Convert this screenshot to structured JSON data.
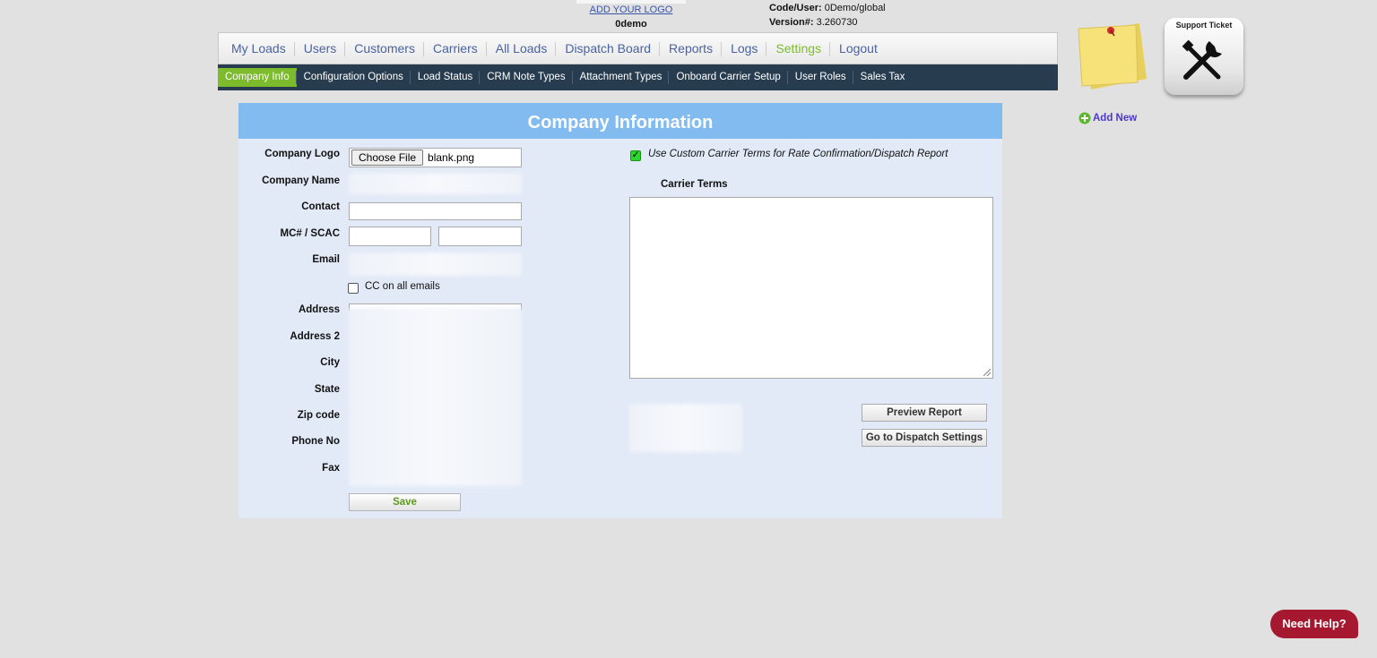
{
  "header": {
    "add_logo_link": "ADD YOUR LOGO",
    "company_code": "0demo",
    "code_user_label": "Code/User:",
    "code_user_value": "0Demo/global",
    "version_label": "Version#:",
    "version_value": "3.260730"
  },
  "main_nav": {
    "items": [
      {
        "label": "My Loads"
      },
      {
        "label": "Users"
      },
      {
        "label": "Customers"
      },
      {
        "label": "Carriers"
      },
      {
        "label": "All Loads"
      },
      {
        "label": "Dispatch Board"
      },
      {
        "label": "Reports"
      },
      {
        "label": "Logs"
      },
      {
        "label": "Settings"
      },
      {
        "label": "Logout"
      }
    ],
    "active": "Settings"
  },
  "sub_nav": {
    "items": [
      {
        "label": "Company Info"
      },
      {
        "label": "Configuration Options"
      },
      {
        "label": "Load Status"
      },
      {
        "label": "CRM Note Types"
      },
      {
        "label": "Attachment Types"
      },
      {
        "label": "Onboard Carrier Setup"
      },
      {
        "label": "User Roles"
      },
      {
        "label": "Sales Tax"
      }
    ],
    "active": "Company Info"
  },
  "panel": {
    "title": "Company Information",
    "labels": {
      "company_logo": "Company Logo",
      "company_name": "Company Name",
      "contact": "Contact",
      "mc_scac": "MC# / SCAC",
      "email": "Email",
      "address": "Address",
      "address2": "Address 2",
      "city": "City",
      "state": "State",
      "zip": "Zip code",
      "phone": "Phone No",
      "fax": "Fax"
    },
    "file_button": "Choose File",
    "file_name": "blank.png",
    "cc_label": "CC on all emails",
    "cc_checked": false,
    "save_button": "Save",
    "custom_terms_label": "Use Custom Carrier Terms for Rate Confirmation/Dispatch Report",
    "custom_terms_checked": true,
    "carrier_terms_label": "Carrier Terms",
    "preview_button": "Preview Report",
    "dispatch_settings_button": "Go to Dispatch Settings"
  },
  "sidebar": {
    "support_ticket_label": "Support Ticket",
    "add_new_label": "Add New"
  },
  "help": {
    "label": "Need Help?"
  },
  "colors": {
    "page_bg": "#e1e1e1",
    "subnav_bg": "#283c4f",
    "accent_green": "#7cbb2b",
    "panel_header": "#82bbef",
    "panel_bg": "#e2eaf7",
    "help_button": "#a5182f"
  },
  "icons": {
    "sticky_note": "sticky-note-icon",
    "support": "tools-icon",
    "add_new": "plus-circle-icon"
  }
}
